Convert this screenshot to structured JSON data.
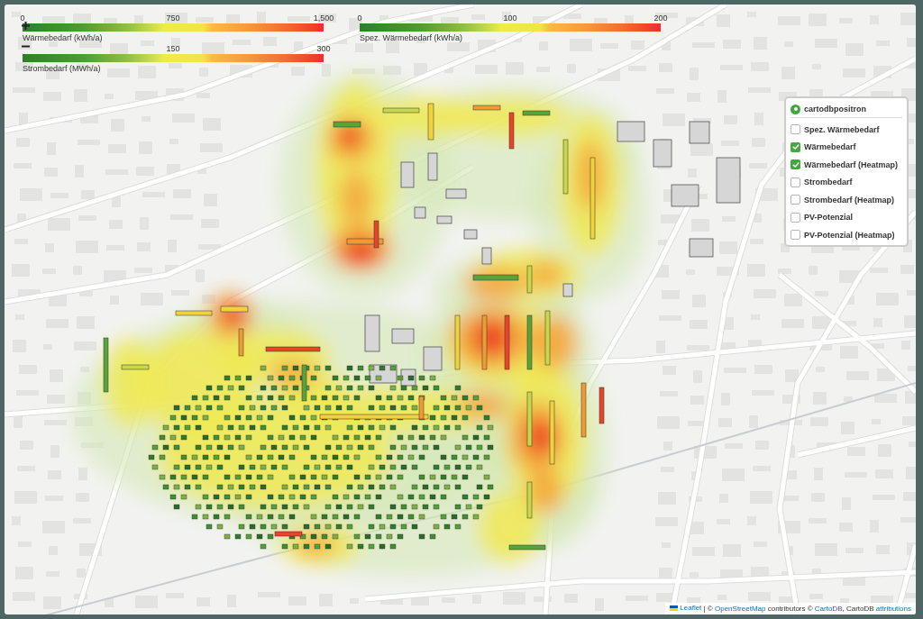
{
  "legends": [
    {
      "title": "Wärmebedarf (kWh/a)",
      "tick_start": "0",
      "tick_middle": "750",
      "tick_end": "1,500"
    },
    {
      "title": "Strombedarf (MWh/a)",
      "tick_middle": "150",
      "tick_end": "300"
    },
    {
      "title": "Spez. Wärmebedarf (kWh/a)",
      "tick_start": "0",
      "tick_middle": "100",
      "tick_end": "200"
    }
  ],
  "layer_control": {
    "base_layers": [
      {
        "label": "cartodbpositron",
        "selected": true
      }
    ],
    "overlays": [
      {
        "label": "Spez. Wärmebedarf",
        "checked": false
      },
      {
        "label": "Wärmebedarf",
        "checked": true
      },
      {
        "label": "Wärmebedarf (Heatmap)",
        "checked": true
      },
      {
        "label": "Strombedarf",
        "checked": false
      },
      {
        "label": "Strombedarf (Heatmap)",
        "checked": false
      },
      {
        "label": "PV-Potenzial",
        "checked": false
      },
      {
        "label": "PV-Potenzial (Heatmap)",
        "checked": false
      }
    ]
  },
  "attribution": [
    {
      "kind": "link",
      "text": "Leaflet",
      "flag": true
    },
    {
      "kind": "text",
      "text": " | © "
    },
    {
      "kind": "link",
      "text": "OpenStreetMap"
    },
    {
      "kind": "text",
      "text": " contributors © "
    },
    {
      "kind": "link",
      "text": "CartoDB"
    },
    {
      "kind": "text",
      "text": ", CartoDB "
    },
    {
      "kind": "link",
      "text": "attributions"
    }
  ]
}
